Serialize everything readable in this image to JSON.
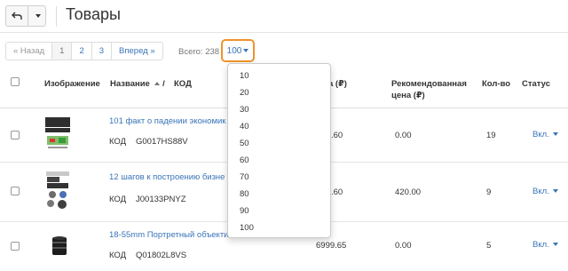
{
  "header": {
    "back_icon": "back-arrow-icon",
    "menu_icon": "caret-down-icon",
    "title": "Товары"
  },
  "pager": {
    "prev": "« Назад",
    "pages": [
      "1",
      "2",
      "3"
    ],
    "next": "Вперед »",
    "total": "Всего: 238",
    "per_page": "100"
  },
  "columns": {
    "image": "Изображение",
    "name": "Название",
    "sort_sep": "/",
    "code": "КОД",
    "price": "a (₽)",
    "recommended_1": "Рекомендованная",
    "recommended_2": "цена (₽)",
    "qty": "Кол-во",
    "status": "Статус"
  },
  "rows": [
    {
      "name": "101 факт о падении экономик",
      "code_label": "КОД",
      "code": "G0017HS88V",
      "price": ".60",
      "recommended": "0.00",
      "qty": "19",
      "status": "Вкл."
    },
    {
      "name": "12 шагов к построению бизне",
      "code_label": "КОД",
      "code": "J00133PNYZ",
      "price": ".60",
      "recommended": "420.00",
      "qty": "9",
      "status": "Вкл."
    },
    {
      "name": "18-55mm Портретный объекти",
      "code_label": "КОД",
      "code": "Q01802L8VS",
      "price": "6999.65",
      "recommended": "0.00",
      "qty": "5",
      "status": "Вкл."
    }
  ],
  "per_page_options": [
    "10",
    "20",
    "30",
    "40",
    "50",
    "60",
    "70",
    "80",
    "90",
    "100"
  ],
  "colors": {
    "link": "#3974b8",
    "highlight": "#f0932b"
  }
}
